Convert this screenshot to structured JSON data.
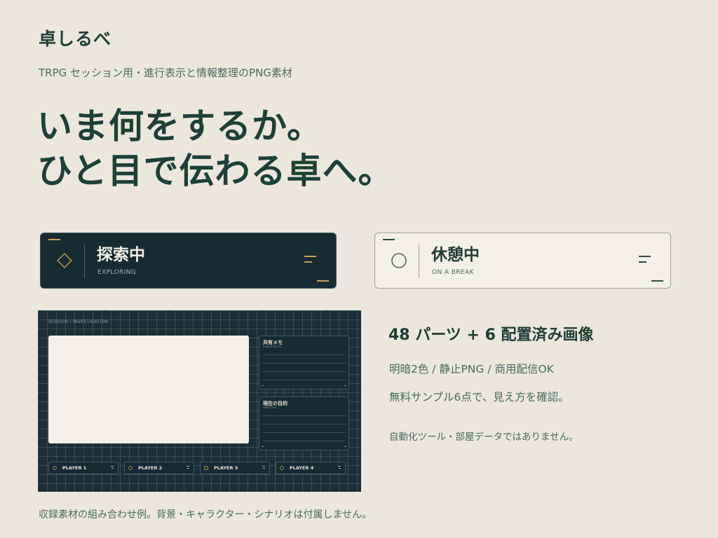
{
  "header": {
    "brand": "卓しるべ",
    "subtitle": "TRPG セッション用・進行表示と情報整理のPNG素材",
    "headline": [
      "いま何をするか。",
      "ひと目で伝わる卓へ。"
    ]
  },
  "status_cards": [
    {
      "label": "探索中",
      "sub": "EXPLORING",
      "theme": "dark",
      "icon": "diamond-icon",
      "accent": "#c9a255"
    },
    {
      "label": "休憩中",
      "sub": "ON A BREAK",
      "theme": "light",
      "icon": "circle-icon",
      "accent": "#2f4a44"
    }
  ],
  "preview": {
    "crumb": "SESSION / INVESTIGATION",
    "panels": [
      {
        "title": "共有メモ",
        "sub": "SHARED NOTES"
      },
      {
        "title": "現在の目的",
        "sub": "OBJECTIVE"
      }
    ],
    "players": [
      "PLAYER 1",
      "PLAYER 2",
      "PLAYER 3",
      "PLAYER 4"
    ],
    "player_icons": [
      "circle-icon",
      "circle-icon",
      "square-icon",
      "circle-icon"
    ]
  },
  "info": {
    "title": "48 パーツ + 6 配置済み画像",
    "lines": [
      "明暗2色 / 静止PNG / 商用配信OK",
      "無料サンプル6点で、見え方を確認。"
    ],
    "note": "自動化ツール・部屋データではありません。"
  },
  "caption": "収録素材の組み合わせ例。背景・キャラクター・シナリオは付属しません。",
  "colors": {
    "background": "#ebe7dc",
    "dark_navy": "#172b33",
    "cream": "#f3f0e7",
    "gold_accent": "#c9a255",
    "text_green": "#1f3d36"
  }
}
